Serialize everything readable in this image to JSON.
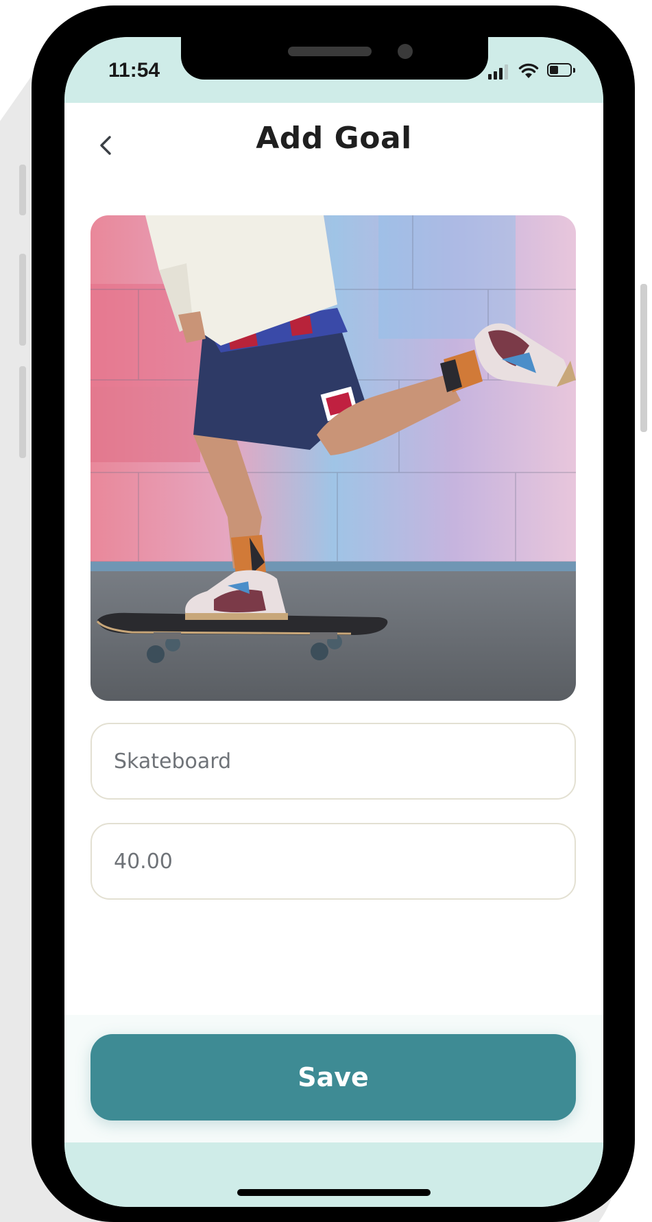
{
  "status_bar": {
    "time": "11:54"
  },
  "header": {
    "title": "Add Goal",
    "back_icon": "chevron-left-icon"
  },
  "goal_image": {
    "description_icon": "photo-skateboarder"
  },
  "form": {
    "name_value": "Skateboard",
    "amount_value": "40.00"
  },
  "actions": {
    "save_label": "Save"
  },
  "colors": {
    "accent": "#3e8b94",
    "status_bar_bg": "#cfece8",
    "field_border": "#e3e0d2"
  }
}
